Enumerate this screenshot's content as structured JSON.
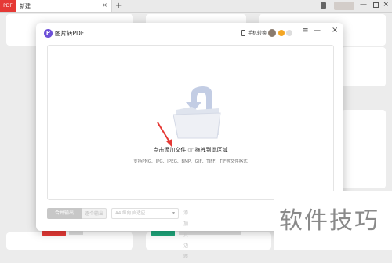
{
  "browser": {
    "tab_pdf": "PDF",
    "tab_new": "新建",
    "tab_close": "×",
    "tab_add": "+",
    "min": "—",
    "close": "×"
  },
  "dialog": {
    "logo": "P",
    "title": "图片转PDF",
    "phone_label": "手机转换",
    "menu": "≡",
    "min": "—",
    "close": "×"
  },
  "drop": {
    "main_click": "点击添加文件",
    "main_or": "or",
    "main_drag": "拖拽到此区域",
    "sub": "支持PNG、JPG、JPEG、BMP、GIF、TIFF、TIF等文件格式"
  },
  "bottom": {
    "merge": "合并输出",
    "single": "逐个输出",
    "page_select": "A4  纵向  自适应",
    "chevron": "▾",
    "margin": "添加页边距"
  },
  "watermark": "软件技巧",
  "colors": {
    "brand_red": "#e53935",
    "logo_purple": "#6c4fd8",
    "accent_green": "#1ea67a"
  }
}
